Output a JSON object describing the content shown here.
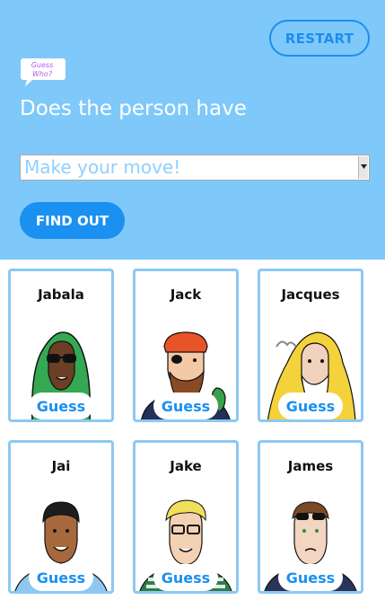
{
  "header": {
    "restart_label": "RESTART",
    "logo_text": "Guess Who?",
    "question": "Does the person have",
    "select_value": "Make your move!",
    "find_out_label": "FIND OUT"
  },
  "cards": [
    {
      "name": "Jabala",
      "guess_label": "Guess"
    },
    {
      "name": "Jack",
      "guess_label": "Guess"
    },
    {
      "name": "Jacques",
      "guess_label": "Guess"
    },
    {
      "name": "Jai",
      "guess_label": "Guess"
    },
    {
      "name": "Jake",
      "guess_label": "Guess"
    },
    {
      "name": "James",
      "guess_label": "Guess"
    }
  ],
  "colors": {
    "header_bg": "#7fc8fa",
    "accent": "#1a90f0",
    "card_border": "#8cc8f4"
  }
}
